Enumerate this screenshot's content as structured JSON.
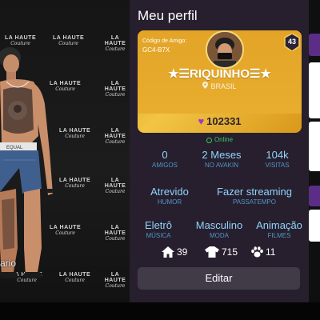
{
  "scene": {
    "watermark_brand": "LA HAUTE",
    "watermark_sub": "Couture",
    "avatar_shirt_text": "EQUAL",
    "bottom_label": "ario"
  },
  "profile": {
    "title": "Meu perfil",
    "card": {
      "friend_code_label": "Código de Amigo:",
      "friend_code": "GC4-B7X",
      "level": "43",
      "username": "★☰RIQUINHO☰★",
      "country": "BRASIL",
      "coins": "102331"
    },
    "status": "Online",
    "stats_row1": [
      {
        "value": "0",
        "label": "AMIGOS"
      },
      {
        "value": "2 Meses",
        "label": "NO AVAKIN"
      },
      {
        "value": "104k",
        "label": "VISITAS"
      }
    ],
    "stats_row2": [
      {
        "value": "Atrevido",
        "label": "HUMOR"
      },
      {
        "value": "Fazer streaming",
        "label": "PASSATEMPO"
      }
    ],
    "stats_row3": [
      {
        "value": "Eletrô",
        "label": "MÚSICA"
      },
      {
        "value": "Masculino",
        "label": "MODA"
      },
      {
        "value": "Animação",
        "label": "FILMES"
      }
    ],
    "counts": {
      "homes": "39",
      "outfits": "715",
      "pets": "11"
    },
    "edit_label": "Editar"
  },
  "colors": {
    "panel_bg": "#271f2d",
    "card_gold": "#e8ad2e",
    "stat_value": "#8fd3ff",
    "stat_label": "#4f95c7",
    "online": "#38c55f",
    "button_bg": "#413a47",
    "side_accent": "#5b2d86",
    "heart": "#a634c6"
  },
  "icons": [
    "location-pin-icon",
    "heart-icon",
    "online-status-icon",
    "house-icon",
    "shirt-icon",
    "paw-icon",
    "level-badge-icon"
  ]
}
